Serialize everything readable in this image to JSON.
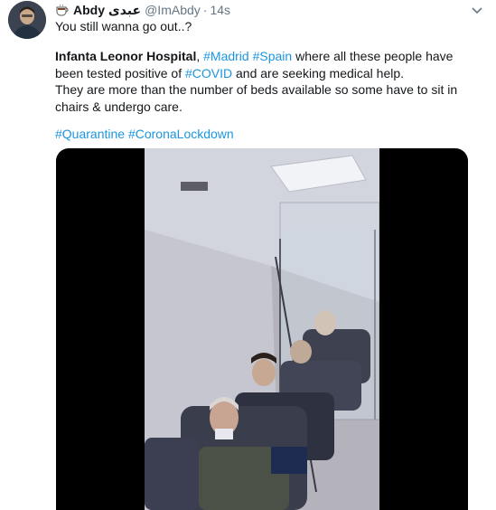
{
  "tweet": {
    "author_name": "Abdy عبدی",
    "handle": "@ImAbdy",
    "separator": "·",
    "time": "14s",
    "line1": "You still wanna go out..?",
    "body_bold": "Infanta Leonor Hospital",
    "body_comma": ",",
    "tag_madrid": "#Madrid",
    "tag_spain": "#Spain",
    "body_text1": "where all these people have been tested positive of",
    "tag_covid": "#COVID",
    "body_text2": "and are seeking medical help.",
    "body_line2": "They are more than the number of beds available so some have to sit in chairs & undergo care.",
    "tag_quarantine": "#Quarantine",
    "tag_lockdown": "#CoronaLockdown"
  },
  "icons": {
    "emoji": "coffee-cup-icon",
    "menu": "chevron-down-icon"
  },
  "colors": {
    "link": "#1b95e0",
    "muted": "#657786",
    "text": "#14171a",
    "video_bg": "#000000"
  }
}
